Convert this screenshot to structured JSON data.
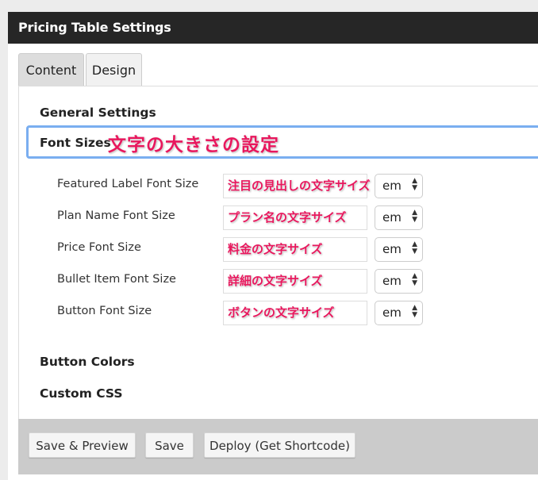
{
  "header": {
    "title": "Pricing Table Settings"
  },
  "tabs": [
    {
      "label": "Content",
      "active": true
    },
    {
      "label": "Design",
      "active": false
    }
  ],
  "sections": {
    "general": "General Settings",
    "font_sizes": "Font Sizes",
    "font_sizes_annotation": "文字の大きさの設定",
    "button_colors": "Button Colors",
    "custom_css": "Custom CSS"
  },
  "font_rows": [
    {
      "label": "Featured Label Font Size",
      "annotation": "注目の見出しの文字サイズ",
      "unit": "em"
    },
    {
      "label": "Plan Name Font Size",
      "annotation": "プラン名の文字サイズ",
      "unit": "em"
    },
    {
      "label": "Price Font Size",
      "annotation": "料金の文字サイズ",
      "unit": "em"
    },
    {
      "label": "Bullet Item Font Size",
      "annotation": "詳細の文字サイズ",
      "unit": "em"
    },
    {
      "label": "Button Font Size",
      "annotation": "ボタンの文字サイズ",
      "unit": "em"
    }
  ],
  "footer": {
    "save_preview": "Save & Preview",
    "save": "Save",
    "deploy": "Deploy (Get Shortcode)"
  },
  "colors": {
    "header_bg": "#262626",
    "focus_border": "#7aaef0",
    "annotation": "#e8175d",
    "footer_bg": "#cbcbcb"
  }
}
